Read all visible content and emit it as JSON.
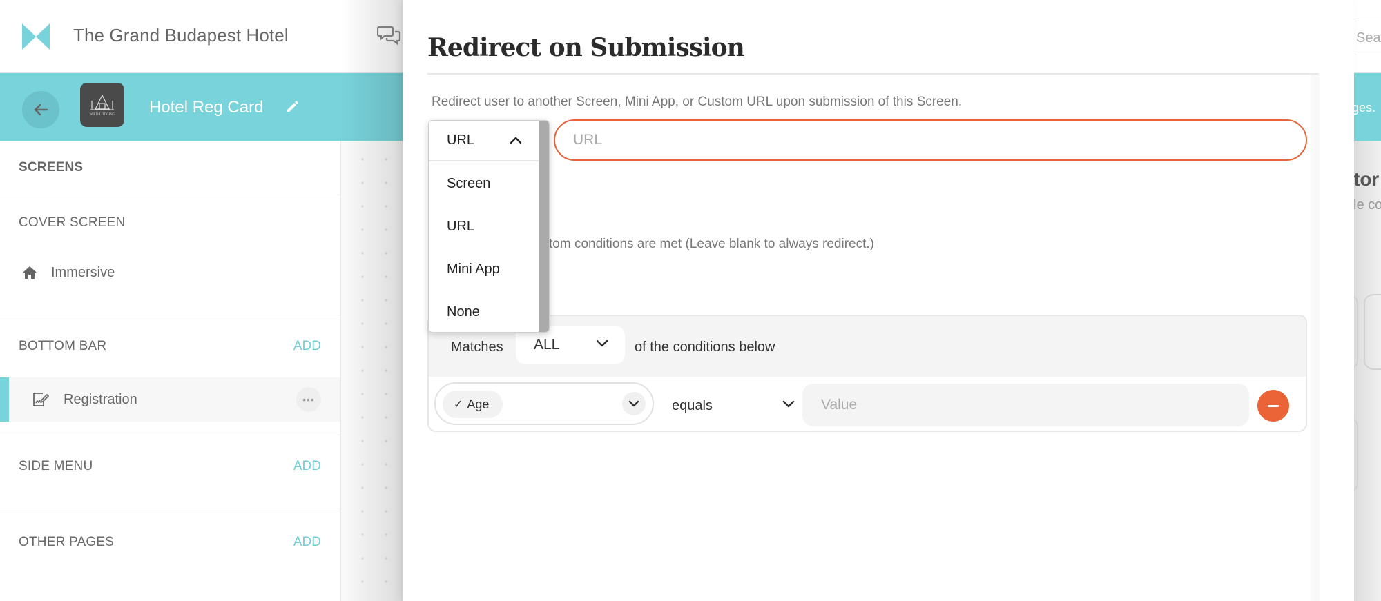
{
  "app": {
    "title": "The Grand Budapest Hotel",
    "search_placeholder_fragment": "Searc",
    "banner_fragment": "ges.",
    "right_panel_title_fragment": "tor",
    "right_panel_sub_fragment": "le co"
  },
  "appbar": {
    "app_name": "Hotel Reg Card",
    "thumb_label": "WILD LODGING"
  },
  "sidebar": {
    "screens_label": "SCREENS",
    "sections": [
      {
        "label": "COVER SCREEN",
        "items": [
          {
            "label": "Immersive",
            "icon": "home-icon"
          }
        ]
      },
      {
        "label": "BOTTOM BAR",
        "add_label": "ADD",
        "items": [
          {
            "label": "Registration",
            "icon": "signature-icon",
            "active": true
          }
        ]
      },
      {
        "label": "SIDE MENU",
        "add_label": "ADD"
      },
      {
        "label": "OTHER PAGES",
        "add_label": "ADD"
      }
    ]
  },
  "modal": {
    "title": "Redirect on Submission",
    "description": "Redirect user to another Screen, Mini App, or Custom URL upon submission of this Screen.",
    "redirect_type": {
      "selected": "URL",
      "options": [
        "Screen",
        "URL",
        "Mini App",
        "None"
      ]
    },
    "url_input": {
      "value": "",
      "placeholder": "URL"
    },
    "conditions_description_visible": "tom conditions are met (Leave blank to always redirect.)",
    "conditions": {
      "matches_label": "Matches",
      "match_mode": "ALL",
      "suffix_label": "of the conditions below",
      "rows": [
        {
          "field": "Age",
          "operator": "equals",
          "value": "",
          "value_placeholder": "Value"
        }
      ]
    }
  },
  "colors": {
    "brand_teal": "#79d3db",
    "accent_orange": "#ea6438",
    "add_link": "#6dd0d9"
  }
}
